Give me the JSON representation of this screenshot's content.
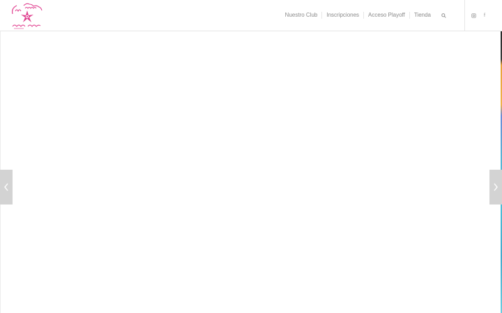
{
  "header": {
    "logo_alt": "club natación ciudad de sanse"
  },
  "nav": {
    "items": [
      {
        "label": "Nuestro Club"
      },
      {
        "label": "Inscripciones"
      },
      {
        "label": "Acceso Playoff"
      },
      {
        "label": "Tienda"
      }
    ],
    "search_icon": "search-icon"
  },
  "social": {
    "items": [
      {
        "icon": "instagram-icon"
      },
      {
        "icon": "facebook-icon",
        "glyph": "f"
      }
    ]
  },
  "slider": {
    "prev_icon": "chevron-left-icon",
    "next_icon": "chevron-right-icon"
  },
  "colors": {
    "brand": "#e0408f",
    "nav_text": "#8a8a8a",
    "arrow_bg": "#d3d3d3"
  }
}
